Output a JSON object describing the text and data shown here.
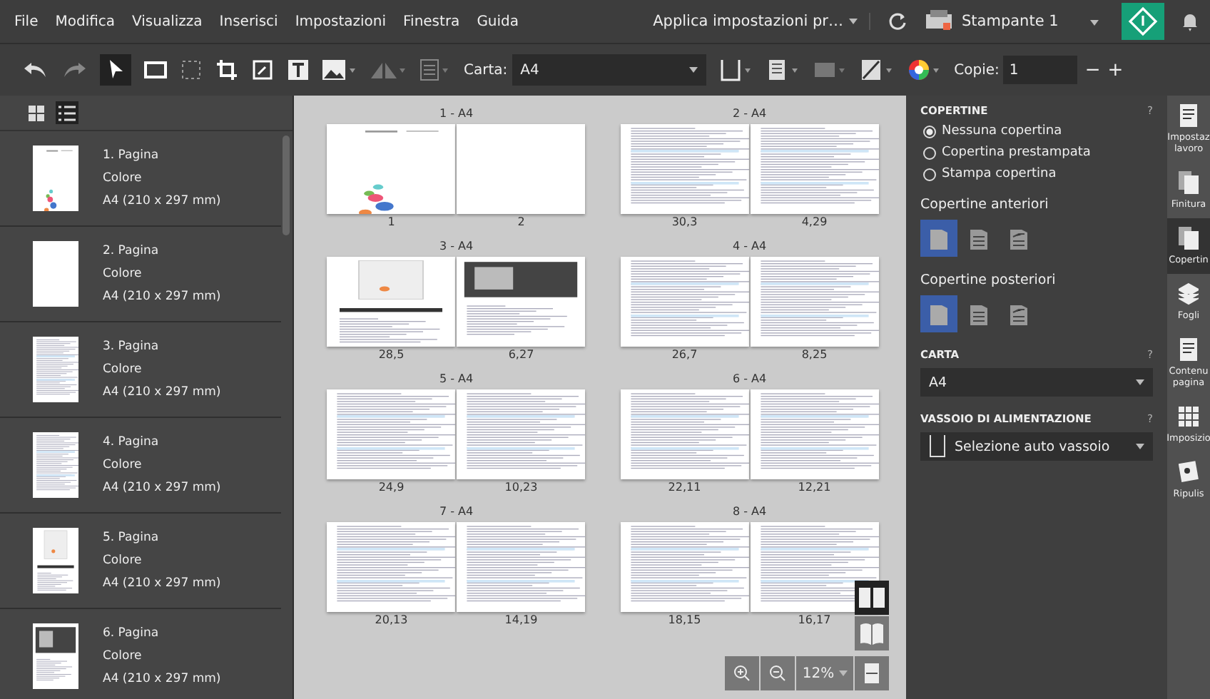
{
  "menu": [
    "File",
    "Modifica",
    "Visualizza",
    "Inserisci",
    "Impostazioni",
    "Finestra",
    "Guida"
  ],
  "header": {
    "apply_settings": "Applica impostazioni pr…",
    "printer": "Stampante 1"
  },
  "toolbar": {
    "paper_label": "Carta:",
    "paper_value": "A4",
    "copies_label": "Copie:",
    "copies_value": "1",
    "minus": "−",
    "plus": "+"
  },
  "view_toggles": [
    {
      "kind": "grid",
      "selected": false
    },
    {
      "kind": "list",
      "selected": true
    }
  ],
  "pages": [
    {
      "title": "1. Pagina",
      "color_mode": "Colore",
      "size": "A4 (210 x 297 mm)",
      "kind": "cover"
    },
    {
      "title": "2. Pagina",
      "color_mode": "Colore",
      "size": "A4 (210 x 297 mm)",
      "kind": "blank"
    },
    {
      "title": "3. Pagina",
      "color_mode": "Colore",
      "size": "A4 (210 x 297 mm)",
      "kind": "text"
    },
    {
      "title": "4. Pagina",
      "color_mode": "Colore",
      "size": "A4 (210 x 297 mm)",
      "kind": "text"
    },
    {
      "title": "5. Pagina",
      "color_mode": "Colore",
      "size": "A4 (210 x 297 mm)",
      "kind": "screens"
    },
    {
      "title": "6. Pagina",
      "color_mode": "Colore",
      "size": "A4 (210 x 297 mm)",
      "kind": "dark"
    }
  ],
  "spreads": [
    {
      "title": "1 - A4",
      "pages": [
        {
          "label": "1",
          "kind": "cover"
        },
        {
          "label": "2",
          "kind": "blank"
        }
      ]
    },
    {
      "title": "2 - A4",
      "pages": [
        {
          "label": "30,3",
          "kind": "text"
        },
        {
          "label": "4,29",
          "kind": "text"
        }
      ]
    },
    {
      "title": "3 - A4",
      "pages": [
        {
          "label": "28,5",
          "kind": "screens"
        },
        {
          "label": "6,27",
          "kind": "dark"
        }
      ]
    },
    {
      "title": "4 - A4",
      "pages": [
        {
          "label": "26,7",
          "kind": "text"
        },
        {
          "label": "8,25",
          "kind": "text"
        }
      ]
    },
    {
      "title": "5 - A4",
      "pages": [
        {
          "label": "24,9",
          "kind": "text"
        },
        {
          "label": "10,23",
          "kind": "text"
        }
      ]
    },
    {
      "title": "6 - A4",
      "pages": [
        {
          "label": "22,11",
          "kind": "text"
        },
        {
          "label": "12,21",
          "kind": "text"
        }
      ]
    },
    {
      "title": "7 - A4",
      "pages": [
        {
          "label": "20,13",
          "kind": "text"
        },
        {
          "label": "14,19",
          "kind": "text"
        }
      ]
    },
    {
      "title": "8 - A4",
      "pages": [
        {
          "label": "18,15",
          "kind": "text"
        },
        {
          "label": "16,17",
          "kind": "text"
        }
      ]
    }
  ],
  "zoom": {
    "value": "12%"
  },
  "view_modes": [
    {
      "kind": "spread",
      "selected": true
    },
    {
      "kind": "book",
      "selected": false
    }
  ],
  "covers": {
    "title": "COPERTINE",
    "help": "?",
    "options": [
      {
        "label": "Nessuna copertina",
        "selected": true
      },
      {
        "label": "Copertina prestampata",
        "selected": false
      },
      {
        "label": "Stampa copertina",
        "selected": false
      }
    ],
    "front_label": "Copertine anteriori",
    "front_options": [
      {
        "kind": "blank",
        "selected": true
      },
      {
        "kind": "lines",
        "selected": false
      },
      {
        "kind": "folded",
        "selected": false
      }
    ],
    "back_label": "Copertine posteriori",
    "back_options": [
      {
        "kind": "blank",
        "selected": true
      },
      {
        "kind": "lines",
        "selected": false
      },
      {
        "kind": "folded",
        "selected": false
      }
    ]
  },
  "paper": {
    "title": "CARTA",
    "help": "?",
    "value": "A4"
  },
  "tray": {
    "title": "VASSOIO DI ALIMENTAZIONE",
    "help": "?",
    "value": "Selezione auto vassoio"
  },
  "side_tabs": [
    {
      "label": "Impostaz lavoro",
      "kind": "job",
      "selected": false
    },
    {
      "label": "Finitura",
      "kind": "finish",
      "selected": false
    },
    {
      "label": "Copertin",
      "kind": "cover",
      "selected": true
    },
    {
      "label": "Fogli",
      "kind": "sheets",
      "selected": false
    },
    {
      "label": "Contenu pagina",
      "kind": "content",
      "selected": false
    },
    {
      "label": "Imposizio",
      "kind": "impose",
      "selected": false
    },
    {
      "label": "Ripulis",
      "kind": "clean",
      "selected": false
    }
  ]
}
